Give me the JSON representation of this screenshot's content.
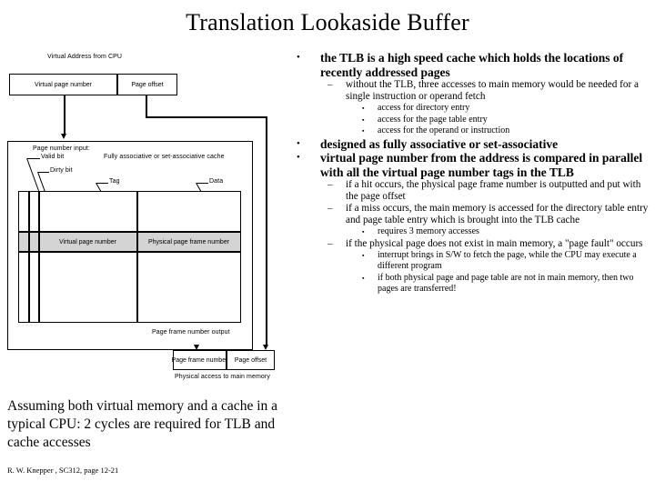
{
  "slide": {
    "title": "Translation Lookaside Buffer",
    "credit": "R. W. Knepper , SC312, page 12-21",
    "assuming_note": "Assuming both virtual memory and a cache in a typical CPU:  2 cycles are required for TLB and cache accesses"
  },
  "diagram": {
    "top_caption": "Virtual Address from CPU",
    "virtual_page_number": "Virtual page number",
    "page_offset": "Page offset",
    "page_number_input": "Page number input:",
    "valid_bit": "Valid bit",
    "dirty_bit": "Dirty bit",
    "cache_type": "Fully associative or set-associative  cache",
    "tag": "Tag",
    "data": "Data",
    "row_tag_value": "Virtual page number",
    "row_data_value": "Physical page frame number",
    "page_frame_output": "Page frame number output",
    "out_page_frame_number": "Page frame number",
    "out_page_offset": "Page offset",
    "bottom_caption": "Physical access to main memory"
  },
  "bullets": {
    "mark_l1": "•",
    "mark_l2": "–",
    "mark_l3": "▪",
    "items": [
      {
        "level": 1,
        "text": "the TLB is a high speed cache which holds the locations of recently addressed pages"
      },
      {
        "level": 2,
        "text": "without the TLB, three accesses to main memory would be needed for a single instruction or operand fetch"
      },
      {
        "level": 3,
        "text": "access for directory entry"
      },
      {
        "level": 3,
        "text": "access for the page table entry"
      },
      {
        "level": 3,
        "text": "access for the operand or instruction"
      },
      {
        "level": 1,
        "text": "designed as fully associative or set-associative"
      },
      {
        "level": 1,
        "text": "virtual page number from the address is compared in parallel with all the virtual page number tags in the TLB"
      },
      {
        "level": 2,
        "text": "if a hit occurs, the physical page frame number is outputted and put with the page offset"
      },
      {
        "level": 2,
        "text": "if a miss occurs, the main memory is accessed for the directory table entry and page table entry which is brought into the TLB cache"
      },
      {
        "level": 3,
        "text": "requires 3 memory accesses"
      },
      {
        "level": 2,
        "text": "if the physical page does not exist in main memory, a \"page fault\" occurs"
      },
      {
        "level": 3,
        "text": "interrupt brings in S/W to fetch the page, while the CPU may execute a different program"
      },
      {
        "level": 3,
        "text": "if both physical page and page table are not in main memory, then two pages are transferred!"
      }
    ]
  },
  "colors": {
    "background": "#ffffff",
    "text": "#000000",
    "highlight_row": "#d4d4d4"
  }
}
